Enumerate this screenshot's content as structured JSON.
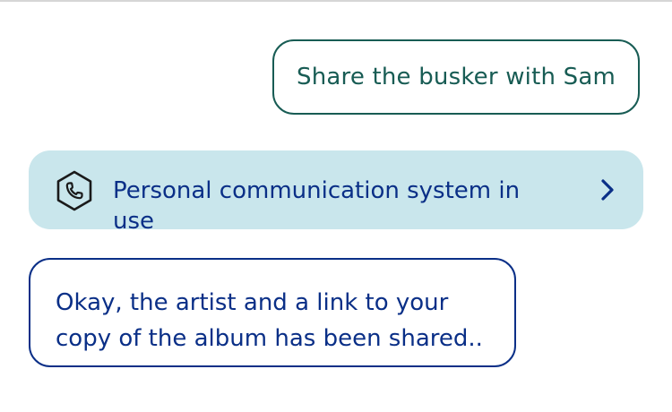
{
  "conversation": {
    "user_message": "Share the busker with Sam",
    "system_status": {
      "label": "Personal communication system in use",
      "icon": "phone-hexagon-icon",
      "action_icon": "chevron-right-icon"
    },
    "assistant_message": "Okay, the artist and a link to your copy of the album has been shared.."
  },
  "colors": {
    "user_text": "#185c54",
    "assistant_text": "#0a2f87",
    "status_background": "#c9e6ec"
  }
}
